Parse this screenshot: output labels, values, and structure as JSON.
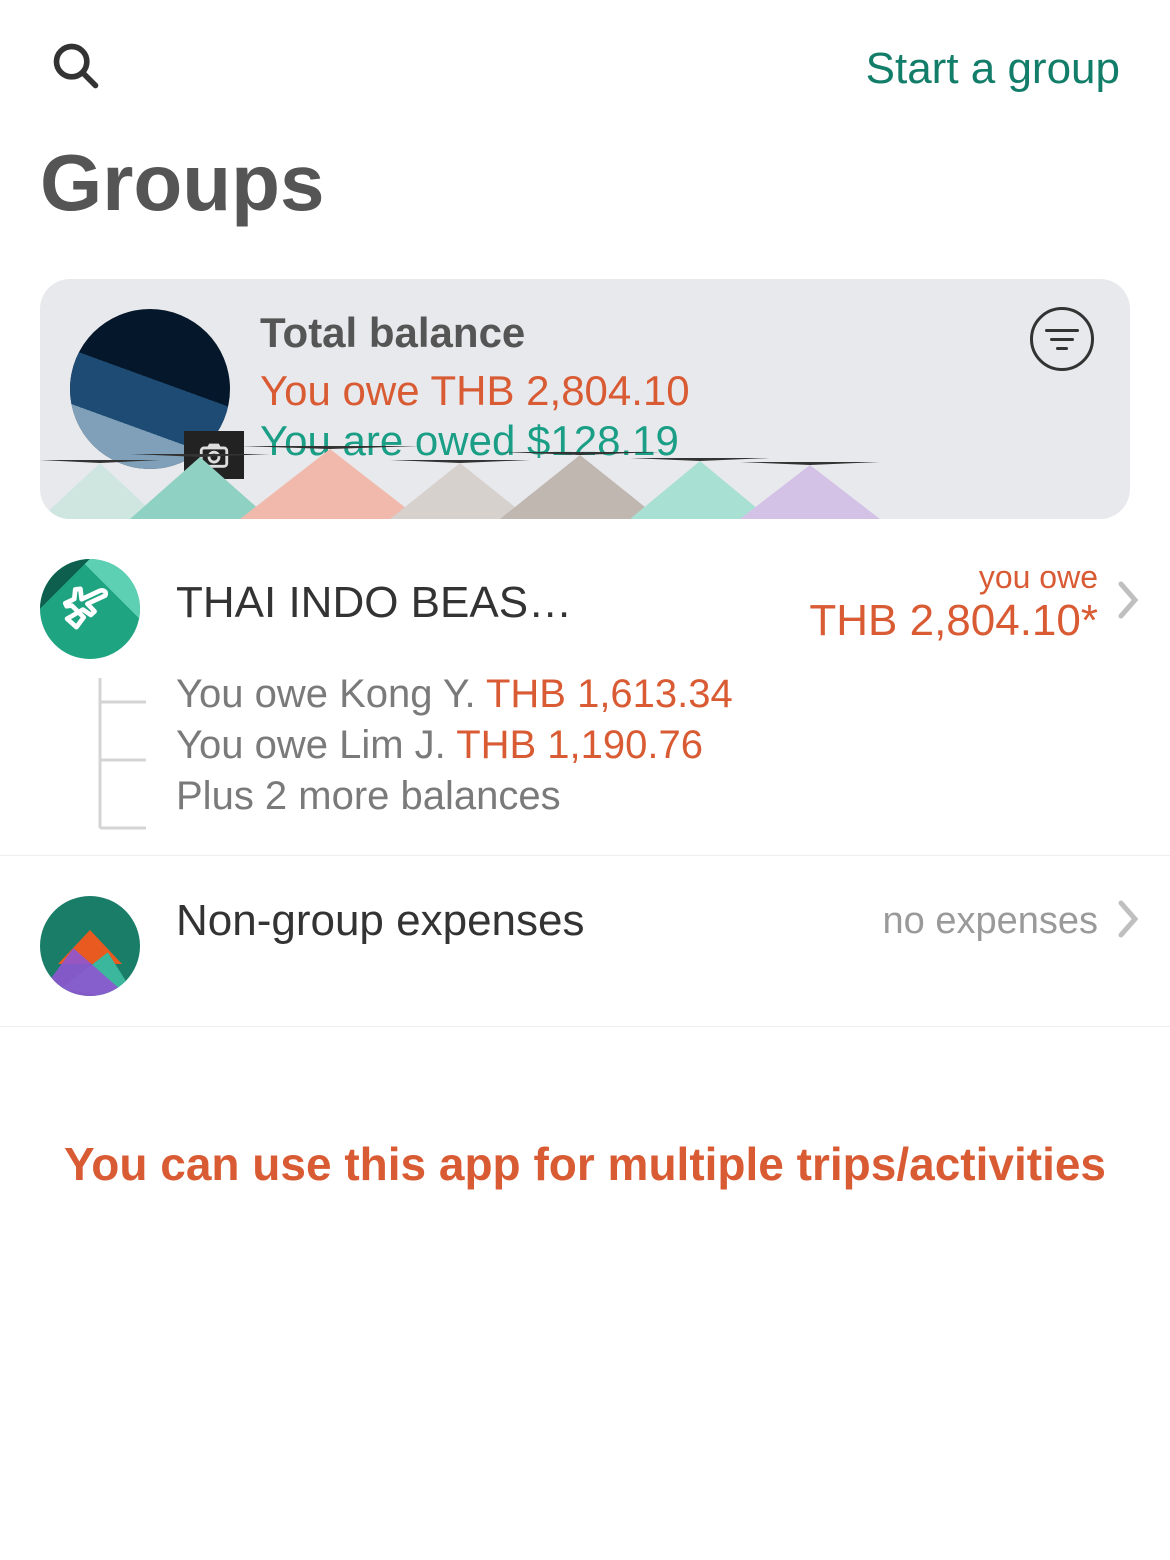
{
  "header": {
    "start_group_label": "Start a group",
    "page_title": "Groups"
  },
  "balance_card": {
    "label": "Total balance",
    "you_owe": "You owe THB 2,804.10",
    "you_are_owed": "You are owed $128.19"
  },
  "groups": [
    {
      "name": "THAI INDO BEAST T…",
      "you_owe_label": "you owe",
      "you_owe_amount": "THB 2,804.10*",
      "details": [
        {
          "prefix": "You owe Kong Y. ",
          "amount": "THB 1,613.34"
        },
        {
          "prefix": "You owe Lim J. ",
          "amount": "THB 1,190.76"
        }
      ],
      "more_balances": "Plus 2 more balances"
    }
  ],
  "non_group": {
    "name": "Non-group expenses",
    "status": "no expenses"
  },
  "footer_message": "You can use this app for multiple trips/activities",
  "colors": {
    "owe": "#d95b34",
    "owed": "#1a9e85",
    "brand": "#127d69"
  }
}
